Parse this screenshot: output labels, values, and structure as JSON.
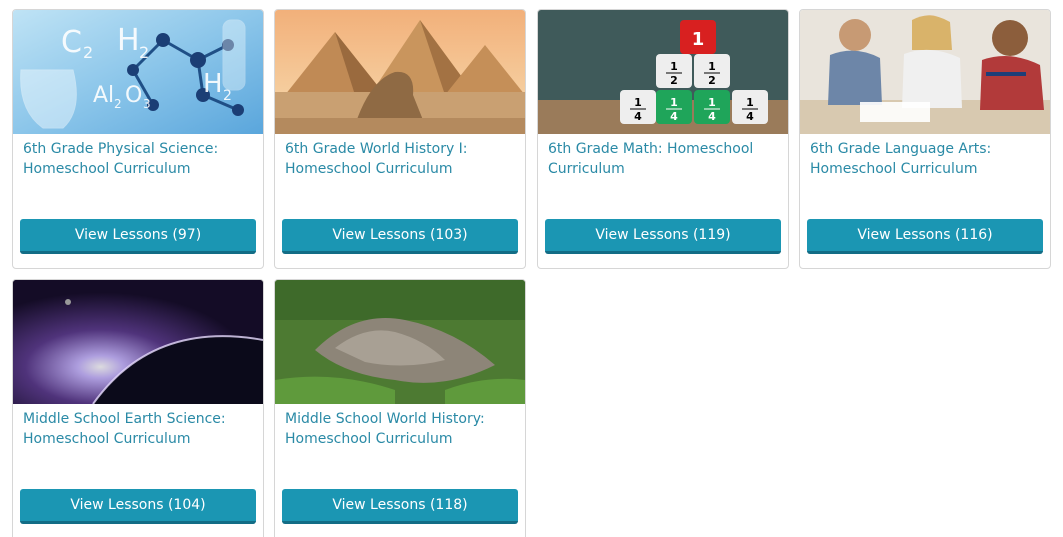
{
  "courses": [
    {
      "title": "6th Grade Physical Science: Homeschool Curriculum",
      "button": "View Lessons (97)",
      "image": "chemistry-molecules-image"
    },
    {
      "title": "6th Grade World History I: Homeschool Curriculum",
      "button": "View Lessons (103)",
      "image": "pyramids-sphinx-image"
    },
    {
      "title": "6th Grade Math: Homeschool Curriculum",
      "button": "View Lessons (119)",
      "image": "fraction-dice-image"
    },
    {
      "title": "6th Grade Language Arts: Homeschool Curriculum",
      "button": "View Lessons (116)",
      "image": "students-writing-image"
    },
    {
      "title": "Middle School Earth Science: Homeschool Curriculum",
      "button": "View Lessons (104)",
      "image": "earth-from-space-image"
    },
    {
      "title": "Middle School World History: Homeschool Curriculum",
      "button": "View Lessons (118)",
      "image": "stone-ruins-image"
    }
  ],
  "thumbnail_text": {
    "chem": [
      "C",
      "2",
      "H",
      "2",
      "Al",
      "2",
      "O",
      "3",
      "H",
      "2"
    ],
    "dice": [
      "1",
      "1",
      "2",
      "1",
      "2",
      "1",
      "4",
      "1",
      "4",
      "1",
      "4",
      "1",
      "4"
    ]
  },
  "colors": {
    "title": "#2a8aa6",
    "button": "#1b96b3",
    "button_shadow": "#136d86"
  }
}
